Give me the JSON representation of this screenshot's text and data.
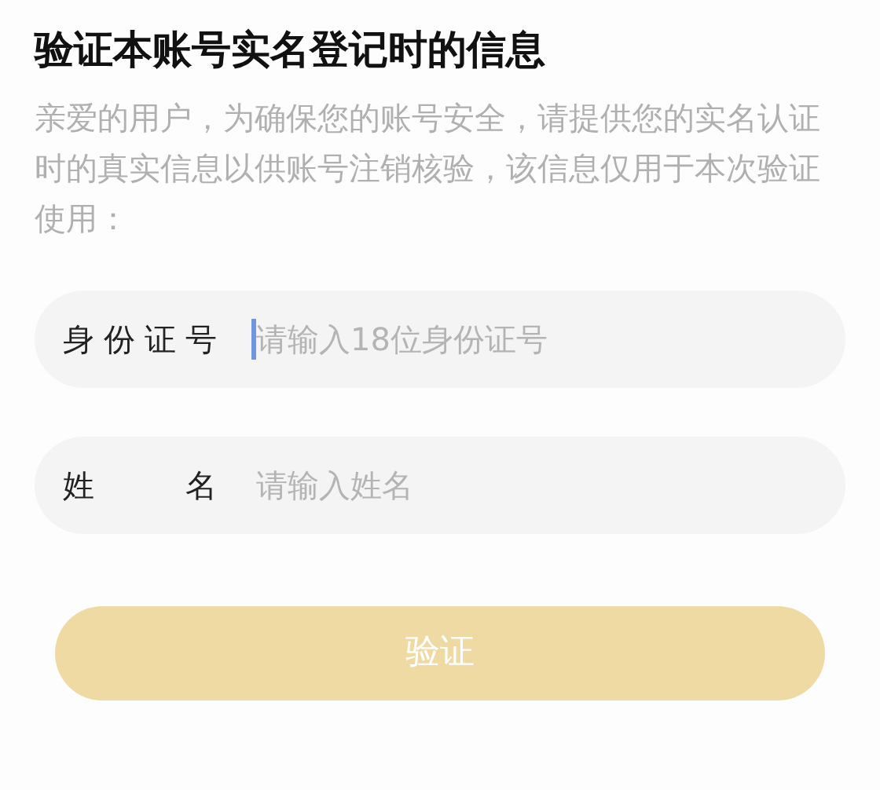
{
  "title": "验证本账号实名登记时的信息",
  "description": "亲爱的用户，为确保您的账号安全，请提供您的实名认证时的真实信息以供账号注销核验，该信息仅用于本次验证使用：",
  "fields": [
    {
      "label": "身份证号",
      "placeholder": "请输入18位身份证号",
      "focused": true
    },
    {
      "label": "姓名",
      "placeholder": "请输入姓名",
      "focused": false
    }
  ],
  "submit_button": {
    "label": "验证",
    "disabled": true
  }
}
